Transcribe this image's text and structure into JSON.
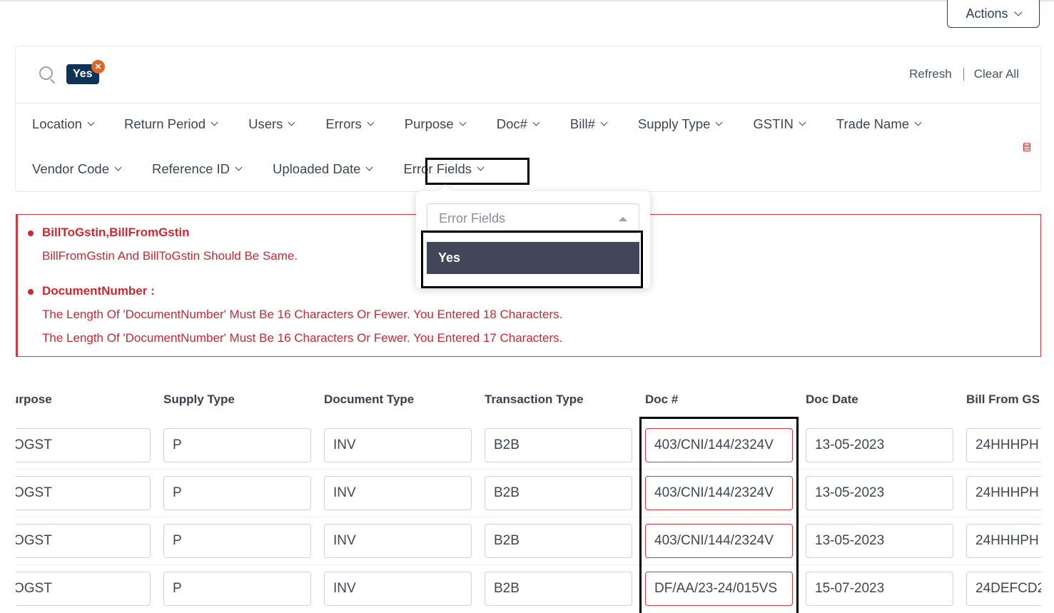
{
  "header": {
    "actions_label": "Actions"
  },
  "search": {
    "chip_label": "Yes",
    "refresh_label": "Refresh",
    "clear_all_label": "Clear All"
  },
  "filters": {
    "row1": [
      "Location",
      "Return Period",
      "Users",
      "Errors",
      "Purpose",
      "Doc#",
      "Bill#",
      "Supply Type",
      "GSTIN",
      "Trade Name"
    ],
    "row2": [
      "Vendor Code",
      "Reference ID",
      "Uploaded Date",
      "Error Fields"
    ]
  },
  "errors": {
    "items": [
      {
        "field": "BillToGstin,BillFromGstin",
        "messages": [
          "BillFromGstin And BillToGstin Should Be Same."
        ]
      },
      {
        "field": "DocumentNumber :",
        "messages": [
          "The Length Of 'DocumentNumber' Must Be 16 Characters Or Fewer. You Entered 18 Characters.",
          "The Length Of 'DocumentNumber' Must Be 16 Characters Or Fewer. You Entered 17 Characters."
        ]
      }
    ]
  },
  "dropdown": {
    "placeholder": "Error Fields",
    "options": [
      "Yes"
    ]
  },
  "table": {
    "headers": [
      "urpose",
      "Supply Type",
      "Document Type",
      "Transaction Type",
      "Doc #",
      "Doc Date",
      "Bill From GS"
    ],
    "rows": [
      [
        "OGST",
        "P",
        "INV",
        "B2B",
        "403/CNI/144/2324V",
        "13-05-2023",
        "24HHHPH"
      ],
      [
        "OGST",
        "P",
        "INV",
        "B2B",
        "403/CNI/144/2324V",
        "13-05-2023",
        "24HHHPH"
      ],
      [
        "OGST",
        "P",
        "INV",
        "B2B",
        "403/CNI/144/2324V",
        "13-05-2023",
        "24HHHPH"
      ],
      [
        "OGST",
        "P",
        "INV",
        "B2B",
        "DF/AA/23-24/015VS",
        "15-07-2023",
        "24DEFCD2"
      ]
    ]
  },
  "colors": {
    "error": "#d0262e",
    "chip": "#0d3458",
    "option_bg": "#414659",
    "clear_badge": "#e0652a"
  }
}
